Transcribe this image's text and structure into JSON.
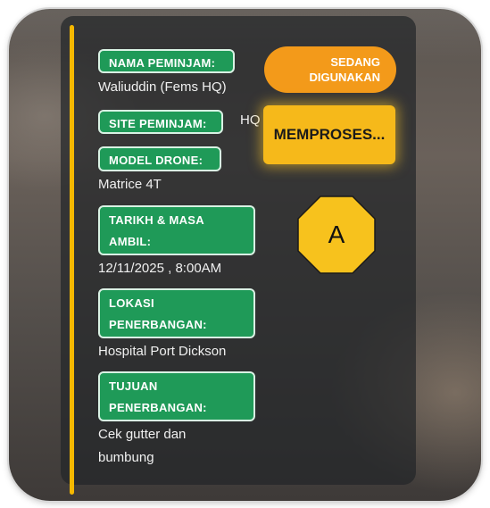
{
  "borrower_name": {
    "label": "NAMA PEMINJAM:",
    "value": "Waliuddin (Fems HQ)"
  },
  "borrower_site": {
    "label": "SITE PEMINJAM:",
    "value": "HQ"
  },
  "drone_model": {
    "label": "MODEL DRONE:",
    "value": "Matrice 4T"
  },
  "pickup_datetime": {
    "label_line1": "TARIKH & MASA",
    "label_line2": "AMBIL:",
    "value": "12/11/2025 , 8:00AM"
  },
  "flight_location": {
    "label_line1": "LOKASI",
    "label_line2": "PENERBANGAN:",
    "value": "Hospital Port Dickson"
  },
  "flight_purpose": {
    "label_line1": "TUJUAN",
    "label_line2": "PENERBANGAN:",
    "value_line1": "Cek gutter dan",
    "value_line2": "bumbung"
  },
  "status": {
    "line1": "SEDANG",
    "line2": "DIGUNAKAN"
  },
  "process_button": {
    "label": "MEMPROSES..."
  },
  "annotation": {
    "label": "A"
  },
  "colors": {
    "accent": "#f5b800",
    "label_green": "#1f9a58",
    "status_orange": "#f39a1a",
    "button_yellow": "#f6b91a",
    "badge_fill": "#f7c21d"
  }
}
